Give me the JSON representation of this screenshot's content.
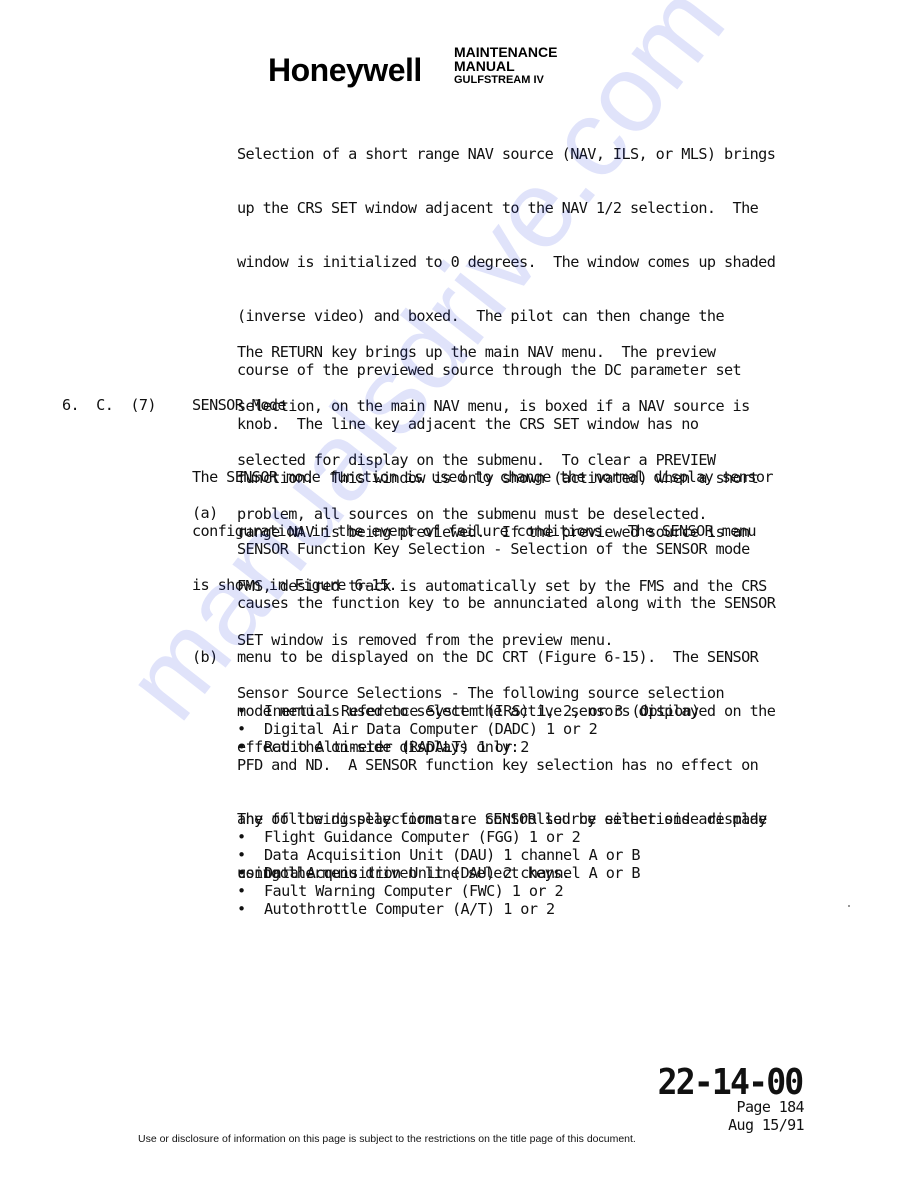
{
  "header": {
    "logo": "Honeywell",
    "title_line1": "MAINTENANCE",
    "title_line2": "MANUAL",
    "title_line3": "GULFSTREAM IV"
  },
  "body": {
    "intro_paragraph": [
      "Selection of a short range NAV source (NAV, ILS, or MLS) brings",
      "up the CRS SET window adjacent to the NAV 1/2 selection.  The",
      "window is initialized to 0 degrees.  The window comes up shaded",
      "(inverse video) and boxed.  The pilot can then change the",
      "course of the previewed source through the DC parameter set",
      "knob.  The line key adjacent the CRS SET window has no",
      "function.  This window is only shown (activated) when a short",
      "range NAV is being previewed.  If the previewed source is an",
      "FMS, desired track is automatically set by the FMS and the CRS",
      "SET window is removed from the preview menu."
    ],
    "return_paragraph": [
      "The RETURN key brings up the main NAV menu.  The preview",
      "selection, on the main NAV menu, is boxed if a NAV source is",
      "selected for display on the submenu.  To clear a PREVIEW",
      "problem, all sources on the submenu must be deselected."
    ],
    "section": {
      "number": "6.  C.  (7)",
      "title": "SENSOR Mode"
    },
    "section_paragraph": [
      "The SENSOR mode function is used to change the normal display sensor",
      "configuration in the event of failure conditions.  The SENSOR menu",
      "is shown in Figure 6-15."
    ],
    "item_a": {
      "label": "(a)",
      "lines": [
        "SENSOR Function Key Selection - Selection of the SENSOR mode",
        "causes the function key to be annunciated along with the SENSOR",
        "menu to be displayed on the DC CRT (Figure 6-15).  The SENSOR",
        "mode menu is used to select the active sensors displayed on the",
        "PFD and ND.  A SENSOR function key selection has no effect on",
        "any of the display formats.  SENSOR source selections are made",
        "using the menu driven line select keys."
      ]
    },
    "item_b": {
      "label": "(b)",
      "lines": [
        "Sensor Source Selections - The following source selection",
        "effect the on-side displays only:"
      ],
      "onside_bullets": [
        "Inertial Reference System (IRS) 1, 2, or 3 (Option)",
        "Digital Air Data Computer (DADC) 1 or 2",
        "Radio Altimeter (RADALT) 1 or 2"
      ],
      "either_side_lines": [
        "The following selections are controlled by either side display",
        "controller:"
      ],
      "either_side_bullets": [
        "Flight Guidance Computer (FGG) 1 or 2",
        "Data Acquisition Unit (DAU) 1 channel A or B",
        "Data Acquisition Unit (DAU) 2 channel A or B",
        "Fault Warning Computer (FWC) 1 or 2",
        "Autothrottle Computer (A/T) 1 or 2"
      ],
      "bullet_glyph": "•"
    }
  },
  "footer": {
    "doc_code": "22-14-00",
    "page": "Page 184",
    "date": "Aug 15/91",
    "notice": "Use or disclosure of information on this page is subject to the restrictions on the title page of this document."
  },
  "watermark": {
    "text": "manualsdrive.com",
    "color": "#2a3fe0"
  }
}
